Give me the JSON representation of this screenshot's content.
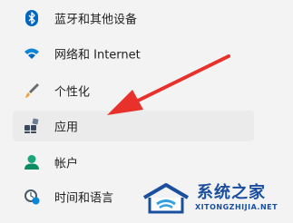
{
  "nav": {
    "items": [
      {
        "label": "蓝牙和其他设备",
        "icon": "bluetooth-icon"
      },
      {
        "label": "网络和 Internet",
        "icon": "wifi-icon"
      },
      {
        "label": "个性化",
        "icon": "brush-icon"
      },
      {
        "label": "应用",
        "icon": "apps-icon",
        "active": true
      },
      {
        "label": "帐户",
        "icon": "account-icon"
      },
      {
        "label": "时间和语言",
        "icon": "time-language-icon"
      }
    ]
  },
  "watermark": {
    "name": "系统之家",
    "url": "XITONGZHIJIA.NET"
  },
  "colors": {
    "accent": "#0067c0",
    "arrow": "#e8312a",
    "background": "#f3f3f3",
    "active_background": "#ebebeb",
    "watermark": "#1a4fa0"
  }
}
